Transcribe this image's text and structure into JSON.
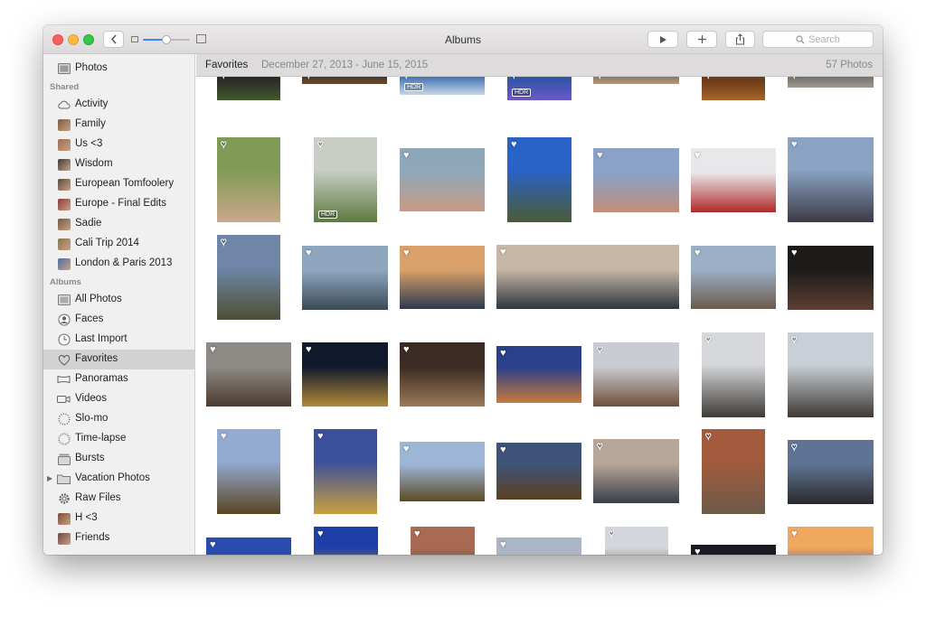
{
  "window": {
    "title": "Albums"
  },
  "toolbar": {
    "search_placeholder": "Search"
  },
  "sidebar": {
    "top": [
      {
        "label": "Photos",
        "icon": "photos-icon"
      }
    ],
    "shared_header": "Shared",
    "shared": [
      {
        "label": "Activity",
        "icon": "cloud-icon"
      },
      {
        "label": "Family",
        "icon": "album-thumbnail-icon",
        "color": "#7b5a3c"
      },
      {
        "label": "Us <3",
        "icon": "album-thumbnail-icon",
        "color": "#9b6c4f"
      },
      {
        "label": "Wisdom",
        "icon": "album-thumbnail-icon",
        "color": "#3d3d3d"
      },
      {
        "label": "European Tomfoolery",
        "icon": "album-thumbnail-icon",
        "color": "#5b4a3a"
      },
      {
        "label": "Europe - Final Edits",
        "icon": "album-thumbnail-icon",
        "color": "#8c3a3a"
      },
      {
        "label": "Sadie",
        "icon": "album-thumbnail-icon",
        "color": "#6e5a45"
      },
      {
        "label": "Cali Trip 2014",
        "icon": "album-thumbnail-icon",
        "color": "#8a7350"
      },
      {
        "label": "London & Paris 2013",
        "icon": "album-thumbnail-icon",
        "color": "#4a6fa3"
      }
    ],
    "albums_header": "Albums",
    "albums": [
      {
        "label": "All Photos",
        "icon": "all-photos-icon"
      },
      {
        "label": "Faces",
        "icon": "faces-icon"
      },
      {
        "label": "Last Import",
        "icon": "clock-icon"
      },
      {
        "label": "Favorites",
        "icon": "heart-icon",
        "selected": true
      },
      {
        "label": "Panoramas",
        "icon": "panorama-icon"
      },
      {
        "label": "Videos",
        "icon": "video-camera-icon"
      },
      {
        "label": "Slo-mo",
        "icon": "slo-mo-icon"
      },
      {
        "label": "Time-lapse",
        "icon": "time-lapse-icon"
      },
      {
        "label": "Bursts",
        "icon": "bursts-icon"
      },
      {
        "label": "Vacation Photos",
        "icon": "folder-icon",
        "disclosure": true
      },
      {
        "label": "Raw Files",
        "icon": "gear-icon"
      },
      {
        "label": "H <3",
        "icon": "album-thumbnail-icon",
        "color": "#7a4d3a"
      },
      {
        "label": "Friends",
        "icon": "album-thumbnail-icon",
        "color": "#6a4a40"
      }
    ]
  },
  "header": {
    "title": "Favorites",
    "date_range": "December 27, 2013 - June 15, 2015",
    "count": "57 Photos"
  },
  "photos": {
    "hdr_label": "HDR",
    "items": [
      {
        "c1": "#2c2a25",
        "c2": "#3f5a2e",
        "heart": false
      },
      {
        "c1": "#3a2f23",
        "c2": "#6b4a2f",
        "heart": false
      },
      {
        "c1": "#4b78b6",
        "c2": "#c7d7e8",
        "heart": false,
        "hdr": true
      },
      {
        "c1": "#3355a8",
        "c2": "#6c58c9",
        "heart": false,
        "hdr": true
      },
      {
        "c1": "#7a6a55",
        "c2": "#b29a84",
        "heart": false
      },
      {
        "c1": "#6b3a18",
        "c2": "#a8642a",
        "heart": false
      },
      {
        "c1": "#6b6a6a",
        "c2": "#a39a8e",
        "heart": false
      },
      {
        "c1": "#7f9b55",
        "c2": "#caa88a",
        "heart": false
      },
      {
        "c1": "#c9cfc6",
        "c2": "#5c7a3e",
        "heart": false,
        "hdr": true
      },
      {
        "c1": "#8fa8b9",
        "c2": "#c89a86",
        "heart": true
      },
      {
        "c1": "#2a63c7",
        "c2": "#4a5b34",
        "heart": true
      },
      {
        "c1": "#8aa1c8",
        "c2": "#c08e78",
        "heart": true
      },
      {
        "c1": "#e8e8ea",
        "c2": "#b02a2a",
        "heart": true
      },
      {
        "c1": "#8aa3c2",
        "c2": "#3b3b46",
        "heart": true
      },
      {
        "c1": "#6f86a9",
        "c2": "#4c5034",
        "heart": false
      },
      {
        "c1": "#8fa6bf",
        "c2": "#3a4a55",
        "heart": true
      },
      {
        "c1": "#d9a06a",
        "c2": "#2b3a4d",
        "heart": true
      },
      {
        "c1": "#c7b7a6",
        "c2": "#2c3640",
        "heart": true
      },
      {
        "c1": "#9bb0c6",
        "c2": "#6b5a4a",
        "heart": true
      },
      {
        "c1": "#1d1b1a",
        "c2": "#5d3f31",
        "heart": true
      },
      {
        "c1": "#8e8a86",
        "c2": "#4b3a2f",
        "heart": true
      },
      {
        "c1": "#111a2c",
        "c2": "#b08a3a",
        "heart": true
      },
      {
        "c1": "#3b2b22",
        "c2": "#9c7a5a",
        "heart": true
      },
      {
        "c1": "#2b3f8a",
        "c2": "#c97b3a",
        "heart": true
      },
      {
        "c1": "#c9ccd3",
        "c2": "#6f4f3a",
        "heart": false
      },
      {
        "c1": "#d5d7da",
        "c2": "#3e3a36",
        "heart": false
      },
      {
        "c1": "#c9cfd6",
        "c2": "#3f3833",
        "heart": false
      },
      {
        "c1": "#93aad1",
        "c2": "#5a4522",
        "heart": true
      },
      {
        "c1": "#3b4f9a",
        "c2": "#c9a040",
        "heart": true
      },
      {
        "c1": "#9eb6d6",
        "c2": "#5a4a25",
        "heart": true
      },
      {
        "c1": "#3f5277",
        "c2": "#5a4220",
        "heart": true
      },
      {
        "c1": "#b7a69a",
        "c2": "#3a3f4a",
        "heart": false
      },
      {
        "c1": "#a45a3c",
        "c2": "#6b5a4a",
        "heart": false
      },
      {
        "c1": "#5f7394",
        "c2": "#2a2a2a",
        "heart": false
      },
      {
        "c1": "#2a4bb0",
        "c2": "#6a4a2a",
        "heart": true
      },
      {
        "c1": "#1e3fa8",
        "c2": "#b0874a",
        "heart": true
      },
      {
        "c1": "#a86a52",
        "c2": "#4b4440",
        "heart": true
      },
      {
        "c1": "#aab6c8",
        "c2": "#c49478",
        "heart": true
      },
      {
        "c1": "#d3d6da",
        "c2": "#6a5a50",
        "heart": false
      },
      {
        "c1": "#1a1a22",
        "c2": "#b09a60",
        "heart": true
      },
      {
        "c1": "#f0a860",
        "c2": "#4a3a5a",
        "heart": true
      }
    ]
  }
}
